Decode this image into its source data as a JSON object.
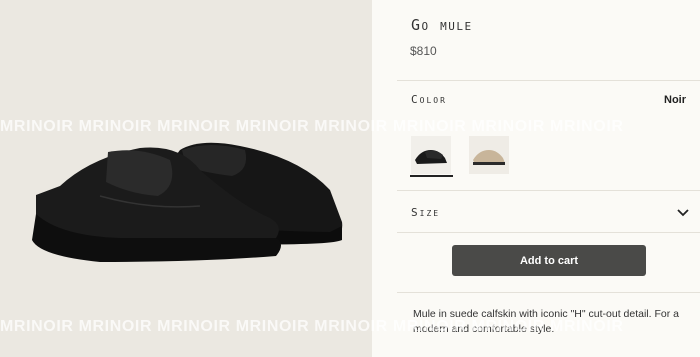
{
  "product": {
    "title": "Go mule",
    "price": "$810",
    "description": "Mule in suede calfskin with iconic \"H\" cut-out detail. For a modern and comfortable style."
  },
  "color": {
    "label": "Color",
    "selected": "Noir",
    "swatches": [
      {
        "name": "Noir",
        "color": "#1a1a1a"
      },
      {
        "name": "Beige",
        "color": "#c8b59a"
      }
    ]
  },
  "size": {
    "label": "Size"
  },
  "cart": {
    "add_label": "Add to cart"
  },
  "watermark": {
    "text": "MRINOIR MRINOIR MRINOIR MRINOIR MRINOIR MRINOIR MRINOIR MRINOIR"
  }
}
